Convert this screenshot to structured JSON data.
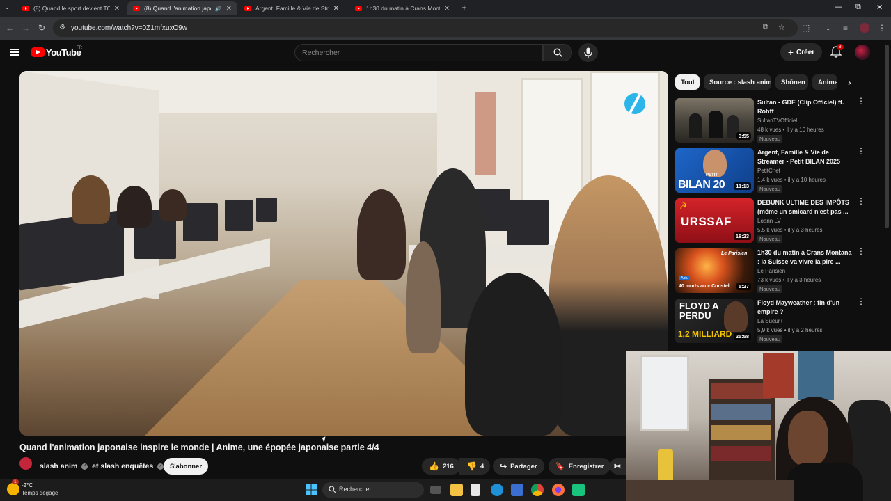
{
  "browser": {
    "tabs": [
      {
        "title": "(8) Quand le sport devient TOXI",
        "active": false
      },
      {
        "title": "(8) Quand l'animation japona",
        "active": true
      },
      {
        "title": "Argent, Famille & Vie de Stream",
        "active": false
      },
      {
        "title": "1h30 du matin à Crans Montana",
        "active": false
      }
    ],
    "url": "youtube.com/watch?v=0Z1mfxuxO9w"
  },
  "youtube": {
    "logo_text": "YouTube",
    "country": "FR",
    "search_placeholder": "Rechercher",
    "create_label": "Créer",
    "notif_count": "8"
  },
  "video": {
    "title": "Quand l'animation japonaise inspire le monde | Anime, une épopée japonaise partie 4/4",
    "channel_primary": "slash anim",
    "channel_connector": "et",
    "channel_secondary": "slash enquêtes",
    "subscribe_label": "S'abonner",
    "likes": "216",
    "dislikes": "4",
    "share_label": "Partager",
    "save_label": "Enregistrer"
  },
  "chips": [
    "Tout",
    "Source : slash anim",
    "Shōnen",
    "Anime"
  ],
  "recommendations": [
    {
      "title": "Sultan - GDE (Clip Officiel) ft. Rohff",
      "channel": "SultanTVOfficiel",
      "meta": "48 k vues • il y a 10 heures",
      "badge": "Nouveau",
      "duration": "3:55",
      "thumb_text": ""
    },
    {
      "title": "Argent, Famille & Vie de Streamer - Petit BILAN 2025",
      "channel": "PetitChef",
      "meta": "1,4 k vues • il y a 10 heures",
      "badge": "Nouveau",
      "duration": "11:13",
      "thumb_text": "BILAN 20",
      "thumb_small": "PETIT"
    },
    {
      "title": "DEBUNK ULTIME DES IMPÔTS (même un smicard n'est pas ...",
      "channel": "Loann LV",
      "meta": "5,5 k vues • il y a 3 heures",
      "badge": "Nouveau",
      "duration": "18:23",
      "thumb_text": "URSSAF"
    },
    {
      "title": "1h30 du matin à Crans Montana : la Suisse va vivre la pire ...",
      "channel": "Le Parisien",
      "meta": "73 k vues • il y a 3 heures",
      "badge": "Nouveau",
      "duration": "5:27",
      "thumb_text": "40 morts au « Constel",
      "thumb_small": "Le Parisien"
    },
    {
      "title": "Floyd Mayweather : fin d'un empire ?",
      "channel": "La Sueur+",
      "meta": "5,9 k vues • il y a 2 heures",
      "badge": "Nouveau",
      "duration": "25:58",
      "thumb_text": "FLOYD A PERDU",
      "thumb_small": "1,2 MILLIARD"
    }
  ],
  "taskbar": {
    "temp": "-2°C",
    "weather": "Temps dégagé",
    "weather_badge": "1",
    "search_label": "Rechercher"
  }
}
